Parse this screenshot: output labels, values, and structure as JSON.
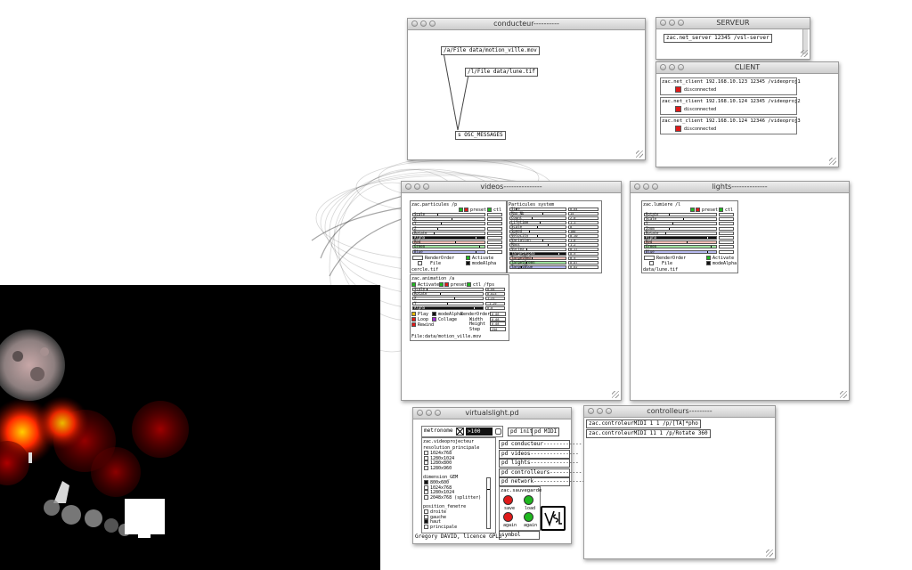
{
  "colors": {
    "green": "#1fb81f",
    "red": "#e01a1a",
    "toggle_black": "#111111",
    "rose": "#f5c0b8",
    "green_bar": "#9fe39f",
    "lilac": "#b7b9f0"
  },
  "conducteur": {
    "title": "conducteur----------",
    "obj1": "/a/File data/motion_ville.mov",
    "obj2": "/l/File data/lune.tif",
    "obj3": "s OSC_MESSAGES"
  },
  "serveur": {
    "title": "SERVEUR",
    "obj": "zac.net_server 12345 /vsl-server"
  },
  "client": {
    "title": "CLIENT",
    "status": "disconnected",
    "rows": [
      "zac.net_client 192.168.10.123 12345 /videoproj1",
      "zac.net_client 192.168.10.124 12345 /videoproj2",
      "zac.net_client 192.168.10.124 12346 /videoproj3"
    ]
  },
  "videos": {
    "title": "videos---------------",
    "part_name": "zac.particules /p",
    "preset": "preset",
    "ctl": "ctl",
    "part_rows": [
      "Scale",
      "X",
      "Y",
      "Z",
      "Rotate",
      "Alpha",
      "Red",
      "Green",
      "Blue"
    ],
    "render_order": "RenderOrder",
    "activate": "Activate",
    "file": "File",
    "mode_alpha": "modeAlpha",
    "file_value": "cercle.tif",
    "ps_name": "Particules system",
    "ps_rows": [
      "Size",
      "Max_Nb",
      "Count",
      "Lifetime",
      "Scale",
      "Speed",
      "Velocity",
      "Variation",
      "Mass",
      "Vortex",
      "TargetAlpha",
      "TargetRed",
      "TargetGreen",
      "TargetBlue"
    ],
    "ps_values": [
      "0.04",
      "15",
      "2.0",
      "1.1",
      "0",
      "100",
      "0.10",
      "1.0",
      "1.2",
      "0.17",
      "0.9",
      "0.5",
      "0.07",
      "0.02"
    ],
    "anim_name": "zac.animation /a",
    "anim_preset": "preset",
    "anim_ctl": "ctl /fps",
    "anim_rows": [
      "Scale",
      "Rotate",
      "X",
      "Y",
      "Alpha"
    ],
    "anim_values": [
      "0.04",
      "0.823",
      "1.21",
      "-1.29",
      "0.8"
    ],
    "anim_opts_left": [
      "Play",
      "Loop",
      "Rewind"
    ],
    "anim_opts_mid": [
      "modeAlpha",
      "Collage"
    ],
    "anim_right": [
      "RenderOrder",
      "Width",
      "Height",
      "Step"
    ],
    "anim_right_vals": [
      "0.06",
      "0.08",
      "0.08",
      "250"
    ],
    "anim_file": "File:data/motion_ville.mov"
  },
  "lights": {
    "title": "lights--------------",
    "name": "zac.lumiere /l",
    "preset": "preset",
    "ctl": "ctl",
    "rows": [
      "Rotate",
      "Scale",
      "Y",
      "Zoom",
      "Rotate",
      "Alpha",
      "Red",
      "Green",
      "Blue"
    ],
    "render_order": "RenderOrder",
    "activate": "Activate",
    "file": "File",
    "mode_alpha": "modeAlpha",
    "file_value": "data/lune.tif"
  },
  "virtualslight": {
    "title": "virtualslight.pd",
    "metronome": "metronome",
    "metro_value": ">100",
    "pd_init": "pd init",
    "pd_midi": "pd MIDI",
    "vp": "zac.videoprojecteur",
    "res_title": "resolution_principale",
    "res": [
      "1024x768",
      "1280x1024",
      "1280x800",
      "1280x960"
    ],
    "gem_title": "dimension_GEM",
    "gem": [
      "800x600",
      "1024x768",
      "1280x1024",
      "2048x768 (splitter)"
    ],
    "pos_title": "position_fenetre",
    "pos": [
      "droite",
      "gauche",
      "haut",
      "principale"
    ],
    "subs": [
      "pd conducteur------------",
      "pd videos---------------",
      "pd lights---------------",
      "pd controlleurs----------",
      "pd network----------------"
    ],
    "save_title": "zac.sauvegarde",
    "save": "save",
    "load": "load",
    "again1": "again",
    "again2": "again",
    "symbol": "symbol",
    "footer": "Gregory DAVID, licence GPL3",
    "logo": "VSL"
  },
  "controleurs": {
    "title": "controlleurs---------",
    "rows": [
      "zac.controleurMIDI 1 1 /p/[TA]*pho",
      "zac.controleurMIDI 11 1 /p/Rotate 360"
    ]
  }
}
